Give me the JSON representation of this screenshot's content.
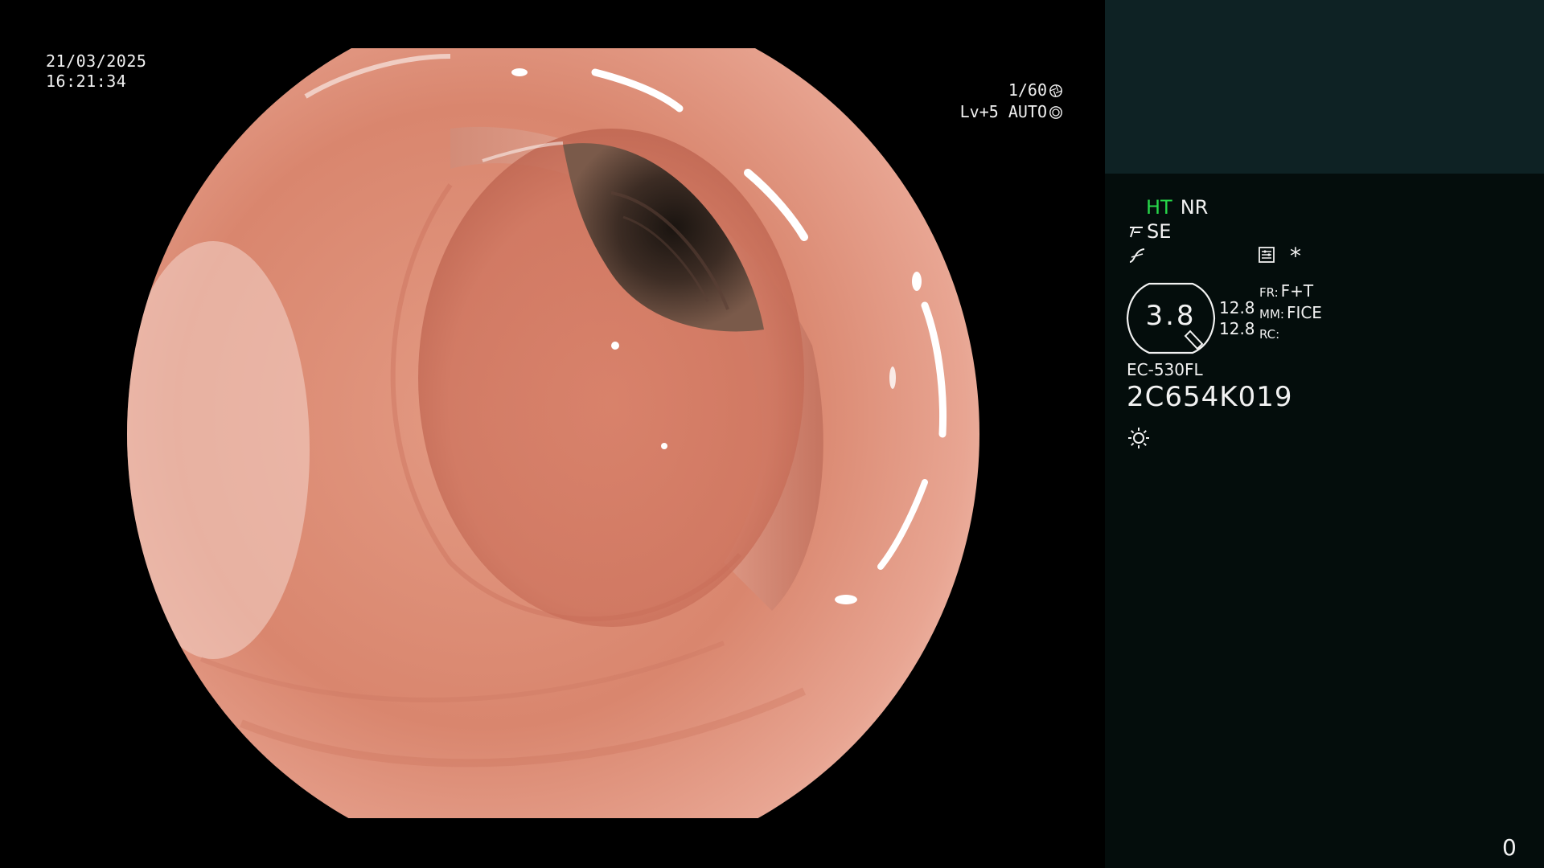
{
  "overlay": {
    "date": "21/03/2025",
    "time": "16:21:34",
    "shutter": "1/60",
    "level": "Lv+5 AUTO",
    "shutter_icon": "aperture-icon",
    "auto_icon": "iris-icon"
  },
  "panel": {
    "mode_ht": "HT",
    "mode_nr": "NR",
    "se_label": "SE",
    "se_icon": "structure-enhance-icon",
    "contrast_icon": "contrast-curve-icon",
    "settings_icon": "settings-panel-icon",
    "asterisk": "*",
    "gauge_value": "3.8",
    "gauge_icon": "gauge-icon",
    "num_top": "12.8",
    "num_bottom": "12.8",
    "fr_key": "FR:",
    "fr_value": "F+T",
    "mm_key": "MM:",
    "mm_value": "FICE",
    "rc_key": "RC:",
    "rc_value": "",
    "model": "EC-530FL",
    "serial": "2C654K019",
    "brightness_icon": "brightness-icon",
    "counter": "0",
    "top_color": "#0e2224",
    "bg_color": "#040d0c",
    "ht_color": "#27d84a"
  }
}
